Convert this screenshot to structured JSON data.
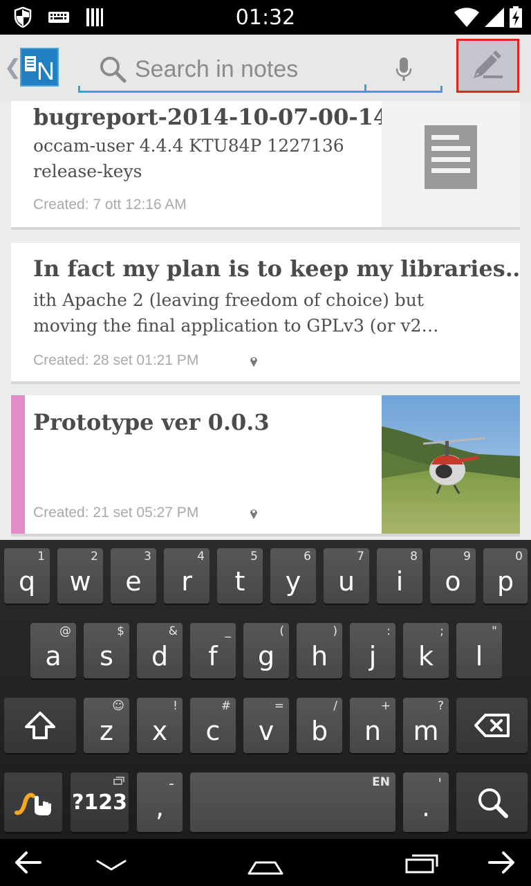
{
  "status_bar": {
    "time": "01:32",
    "left_icons": [
      "shield-icon",
      "keyboard-icon",
      "notification-bars-icon"
    ],
    "right_icons": [
      "wifi-icon",
      "signal-icon",
      "battery-charging-icon"
    ]
  },
  "action_bar": {
    "logo_text": "N",
    "search_placeholder": "Search in notes",
    "icons": [
      "back-chevron-icon",
      "app-logo-icon",
      "search-icon",
      "mic-icon",
      "edit-pencil-icon"
    ]
  },
  "notes": [
    {
      "title": "bugreport-2014-10-07-00-14",
      "body_lines": [
        "occam-user 4.4.4 KTU84P 1227136",
        "release-keys"
      ],
      "date": "Created: 7 ott 12:16 AM",
      "thumbnail": "document-icon"
    },
    {
      "title": "In fact my plan is to keep my libraries…",
      "body_lines": [
        "ith Apache 2 (leaving freedom of choice) but",
        "moving the final application to GPLv3 (or v2…"
      ],
      "date": "Created: 28 set 01:21 PM",
      "has_location": true
    },
    {
      "title": "Prototype ver 0.0.3",
      "body_lines": [],
      "date": "Created: 21 set 05:27 PM",
      "has_location": true,
      "category_color": "#e08cc8",
      "thumbnail": "helicopter-photo"
    }
  ],
  "keyboard": {
    "row1": [
      {
        "key": "q",
        "hint": "1"
      },
      {
        "key": "w",
        "hint": "2"
      },
      {
        "key": "e",
        "hint": "3"
      },
      {
        "key": "r",
        "hint": "4"
      },
      {
        "key": "t",
        "hint": "5"
      },
      {
        "key": "y",
        "hint": "6"
      },
      {
        "key": "u",
        "hint": "7"
      },
      {
        "key": "i",
        "hint": "8"
      },
      {
        "key": "o",
        "hint": "9"
      },
      {
        "key": "p",
        "hint": "0"
      }
    ],
    "row2": [
      {
        "key": "a",
        "hint": "@"
      },
      {
        "key": "s",
        "hint": "$"
      },
      {
        "key": "d",
        "hint": "&"
      },
      {
        "key": "f",
        "hint": "_"
      },
      {
        "key": "g",
        "hint": "("
      },
      {
        "key": "h",
        "hint": ")"
      },
      {
        "key": "j",
        "hint": ":"
      },
      {
        "key": "k",
        "hint": ";"
      },
      {
        "key": "l",
        "hint": "\""
      }
    ],
    "row3": [
      {
        "key": "z",
        "hint": "☺"
      },
      {
        "key": "x",
        "hint": "!"
      },
      {
        "key": "c",
        "hint": "#"
      },
      {
        "key": "v",
        "hint": "="
      },
      {
        "key": "b",
        "hint": "/"
      },
      {
        "key": "n",
        "hint": "+"
      },
      {
        "key": "m",
        "hint": "?"
      }
    ],
    "symbols_label": "?123",
    "comma_key": ",",
    "comma_hint": "-",
    "space_hint": "EN",
    "period_key": ".",
    "period_hint": "'",
    "accent_color": "#f5a623"
  },
  "nav_bar": {
    "icons": [
      "back-arrow-icon",
      "hide-keyboard-icon",
      "home-icon",
      "recents-icon",
      "forward-arrow-icon"
    ]
  }
}
